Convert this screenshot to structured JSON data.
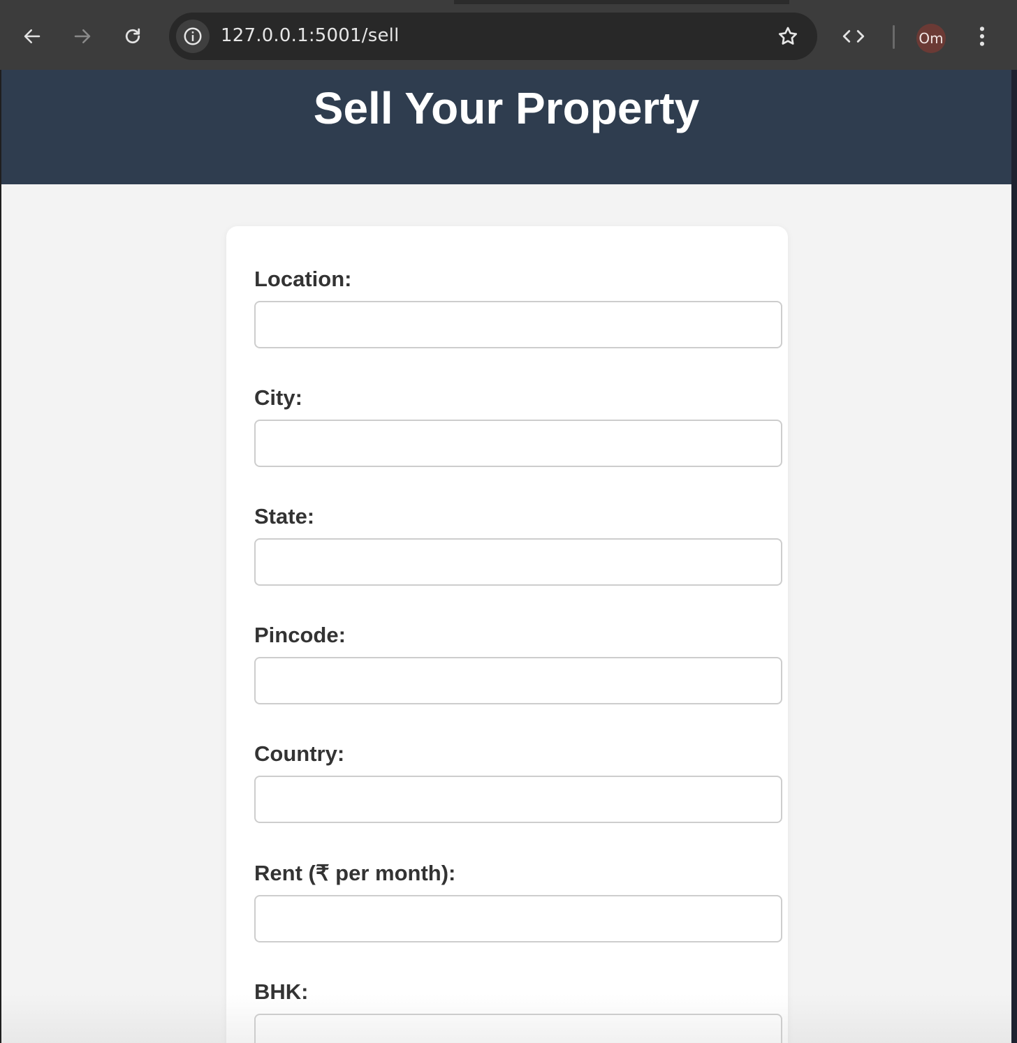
{
  "browser": {
    "url": "127.0.0.1:5001/sell",
    "profile_initials": "Om",
    "icons": {
      "back": "arrow-left-icon",
      "forward": "arrow-right-icon",
      "reload": "reload-icon",
      "site_info": "info-icon",
      "bookmark": "star-icon",
      "devtools": "code-icon",
      "menu": "kebab-menu-icon"
    }
  },
  "header": {
    "title": "Sell Your Property",
    "background_color": "#2f3d4f"
  },
  "form": {
    "fields": [
      {
        "label": "Location:",
        "value": ""
      },
      {
        "label": "City:",
        "value": ""
      },
      {
        "label": "State:",
        "value": ""
      },
      {
        "label": "Pincode:",
        "value": ""
      },
      {
        "label": "Country:",
        "value": ""
      },
      {
        "label": "Rent (₹ per month):",
        "value": ""
      },
      {
        "label": "BHK:",
        "value": ""
      }
    ]
  }
}
